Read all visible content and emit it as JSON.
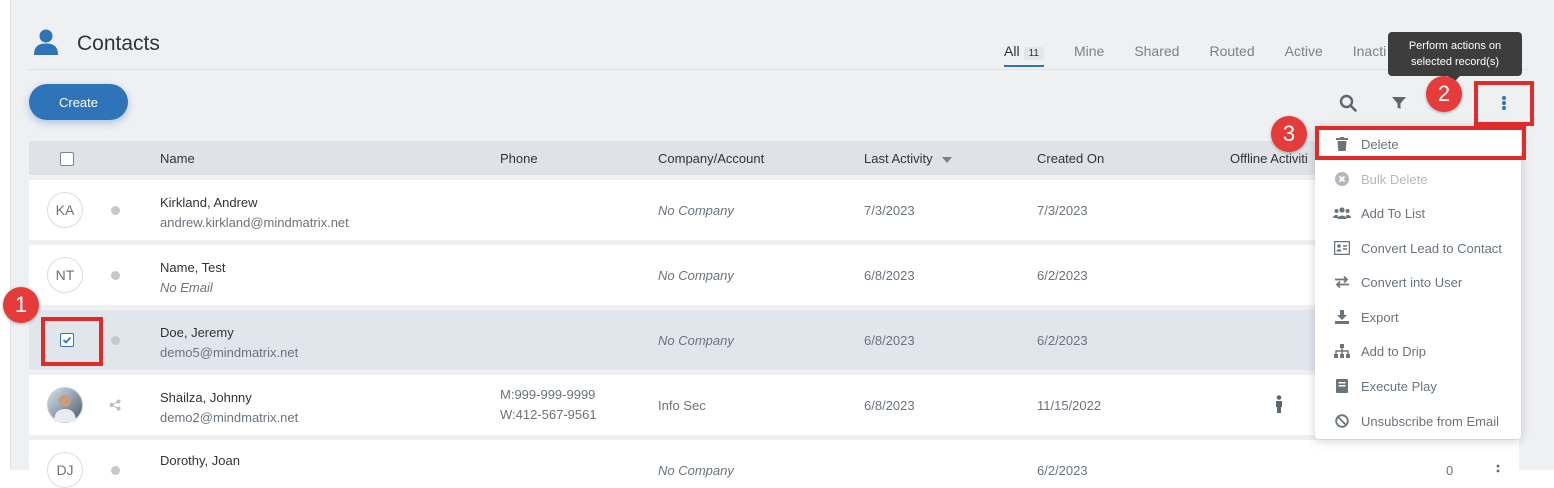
{
  "header": {
    "title": "Contacts",
    "tabs": [
      {
        "label": "All",
        "count": "11"
      },
      {
        "label": "Mine"
      },
      {
        "label": "Shared"
      },
      {
        "label": "Routed"
      },
      {
        "label": "Active"
      },
      {
        "label": "Inacti"
      }
    ]
  },
  "toolbar": {
    "create_label": "Create",
    "tooltip_line1": "Perform actions on",
    "tooltip_line2": "selected record(s)"
  },
  "table": {
    "columns": [
      "Name",
      "Phone",
      "Company/Account",
      "Last Activity",
      "Created On",
      "Offline Activiti"
    ],
    "rows": [
      {
        "initials": "KA",
        "name": "Kirkland, Andrew",
        "email": "andrew.kirkland@mindmatrix.net",
        "phone1": "",
        "phone2": "",
        "company": "No Company",
        "last_activity": "7/3/2023",
        "created_on": "7/3/2023"
      },
      {
        "initials": "NT",
        "name": "Name, Test",
        "email": "No Email",
        "phone1": "",
        "phone2": "",
        "company": "No Company",
        "last_activity": "6/8/2023",
        "created_on": "6/2/2023"
      },
      {
        "initials": "",
        "name": "Doe, Jeremy",
        "email": "demo5@mindmatrix.net",
        "phone1": "",
        "phone2": "",
        "company": "No Company",
        "last_activity": "6/8/2023",
        "created_on": "6/2/2023"
      },
      {
        "initials": "",
        "name": "Shailza, Johnny",
        "email": "demo2@mindmatrix.net",
        "phone1": "M:999-999-9999",
        "phone2": "W:412-567-9561",
        "company": "Info Sec",
        "last_activity": "6/8/2023",
        "created_on": "11/15/2022"
      },
      {
        "initials": "DJ",
        "name": "Dorothy, Joan",
        "email": "",
        "phone1": "",
        "phone2": "",
        "company": "No Company",
        "last_activity": "",
        "created_on": "6/2/2023",
        "offline": "0"
      }
    ]
  },
  "menu": {
    "items": [
      {
        "label": "Delete",
        "icon": "trash-icon"
      },
      {
        "label": "Bulk Delete",
        "icon": "x-circle-icon"
      },
      {
        "label": "Add To List",
        "icon": "users-icon"
      },
      {
        "label": "Convert Lead to Contact",
        "icon": "convert-icon"
      },
      {
        "label": "Convert into User",
        "icon": "swap-icon"
      },
      {
        "label": "Export",
        "icon": "download-icon"
      },
      {
        "label": "Add to Drip",
        "icon": "sitemap-icon"
      },
      {
        "label": "Execute Play",
        "icon": "book-icon"
      },
      {
        "label": "Unsubscribe from Email",
        "icon": "ban-icon"
      }
    ]
  },
  "callouts": [
    "1",
    "2",
    "3"
  ],
  "colors": {
    "accent": "#2f73b8",
    "callout": "#e02b2b"
  }
}
